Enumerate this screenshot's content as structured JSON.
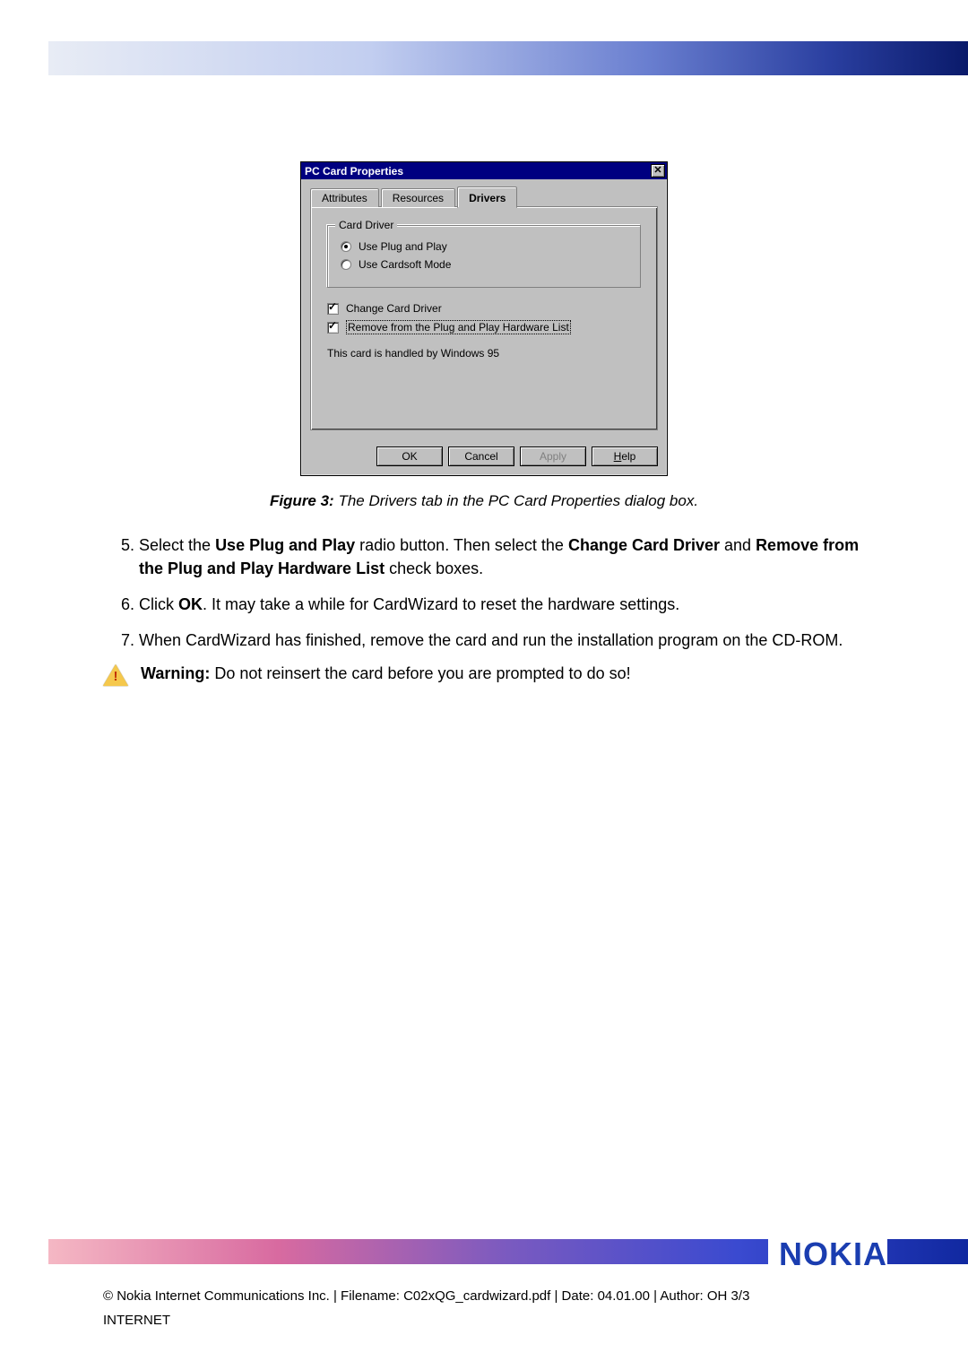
{
  "dialog": {
    "title": "PC Card Properties",
    "tabs": [
      "Attributes",
      "Resources",
      "Drivers"
    ],
    "active_tab": 2,
    "group_label": "Card Driver",
    "radios": [
      {
        "label": "Use Plug and Play",
        "checked": true
      },
      {
        "label": "Use Cardsoft Mode",
        "checked": false
      }
    ],
    "checks": [
      {
        "label": "Change Card Driver",
        "checked": true,
        "focus": false
      },
      {
        "label": "Remove from the Plug and Play Hardware List",
        "checked": true,
        "focus": true
      }
    ],
    "status": "This card is handled by Windows 95",
    "buttons": {
      "ok": "OK",
      "cancel": "Cancel",
      "apply": "Apply",
      "help": "Help"
    }
  },
  "caption": {
    "label": "Figure 3:",
    "text": "The Drivers tab in the PC Card Properties dialog box."
  },
  "steps": {
    "start": 5,
    "items": [
      {
        "parts": [
          {
            "t": "Select the "
          },
          {
            "b": "Use Plug and Play"
          },
          {
            "t": " radio button. Then select the "
          },
          {
            "b": "Change Card Driver"
          },
          {
            "t": " and "
          },
          {
            "b": "Remove from the Plug and Play Hardware List"
          },
          {
            "t": " check boxes."
          }
        ]
      },
      {
        "parts": [
          {
            "t": "Click "
          },
          {
            "b": "OK"
          },
          {
            "t": ". It may take a while for CardWizard to reset the hardware settings."
          }
        ]
      },
      {
        "parts": [
          {
            "t": "When CardWizard has finished, remove the card and run the installation program on the CD-ROM."
          }
        ]
      }
    ]
  },
  "warning": {
    "label": "Warning:",
    "text": "Do not reinsert the card before you are prompted to do so!"
  },
  "logo": "NOKIA",
  "footer": {
    "line1": "© Nokia Internet Communications Inc. | Filename: C02xQG_cardwizard.pdf | Date: 04.01.00 | Author: OH  3/3",
    "line2": "INTERNET"
  }
}
